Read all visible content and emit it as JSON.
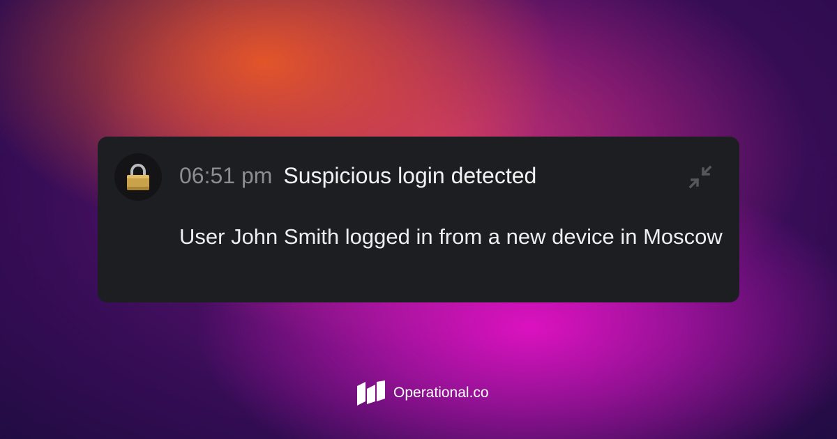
{
  "notification": {
    "icon": "lock-icon",
    "time": "06:51 pm",
    "title": "Suspicious login detected",
    "message": "User John Smith logged in from a new device in Moscow",
    "collapse_icon": "collapse-arrows-icon"
  },
  "brand": {
    "logo_icon": "operational-logo-icon",
    "name": "Operational.co"
  },
  "colors": {
    "card_background": "#1d1e21",
    "time_text": "#8c8d91",
    "title_text": "#f2f2f3",
    "lock_gold": "#c9a24a"
  }
}
